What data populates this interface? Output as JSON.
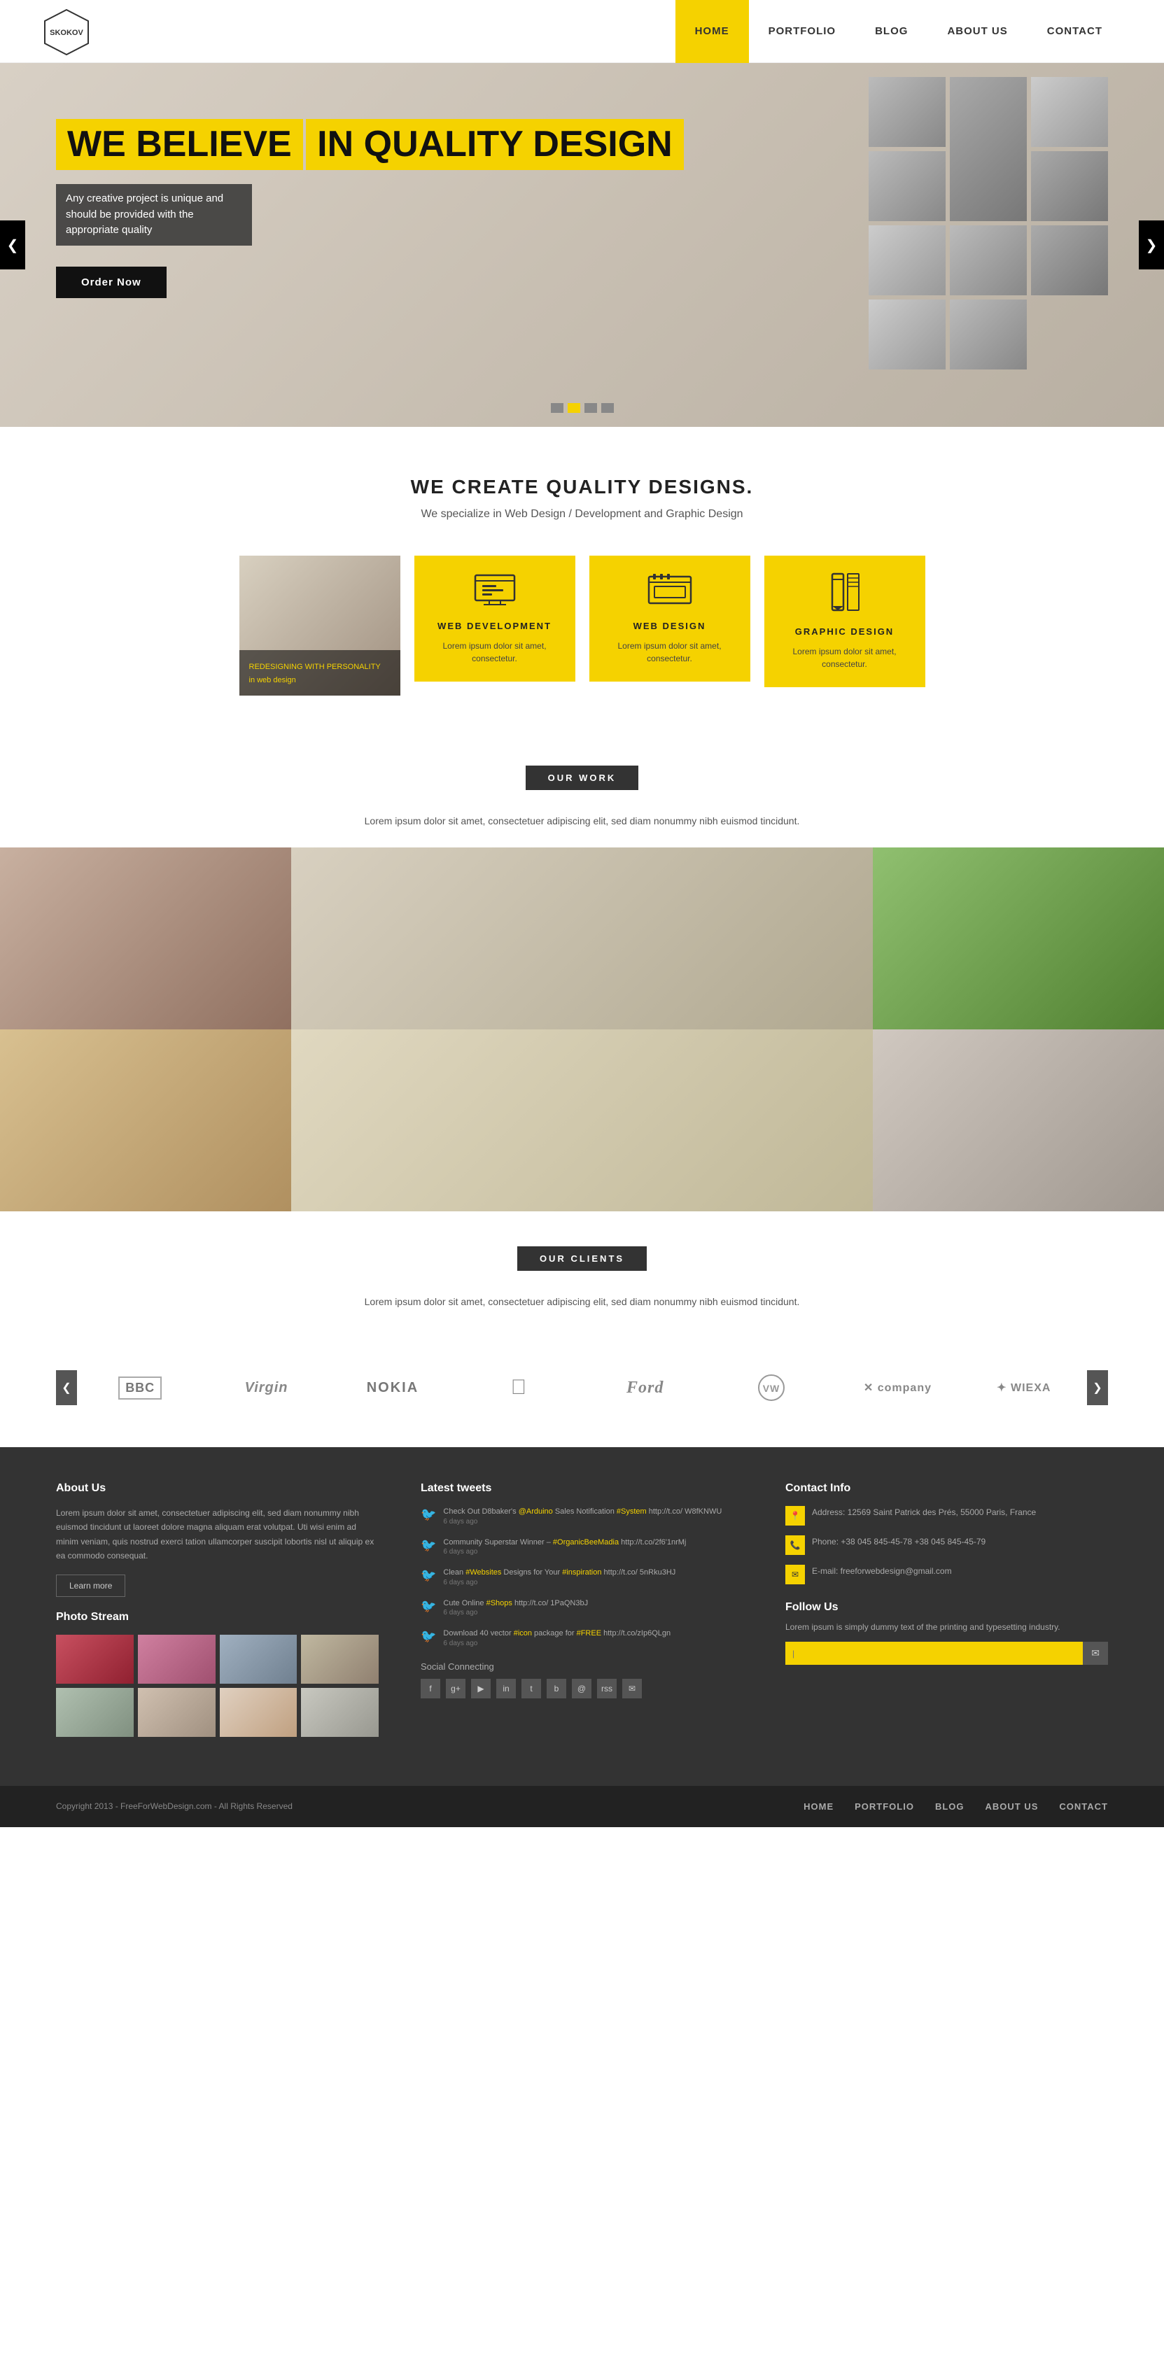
{
  "header": {
    "logo_text": "SKOKOV",
    "nav": [
      {
        "label": "HOME",
        "active": true
      },
      {
        "label": "PORTFOLIO",
        "active": false
      },
      {
        "label": "BLOG",
        "active": false
      },
      {
        "label": "ABOUT US",
        "active": false
      },
      {
        "label": "CONTACT",
        "active": false
      }
    ]
  },
  "hero": {
    "title_line1": "WE BELIEVE",
    "title_line2": "IN QUALITY DESIGN",
    "subtitle": "Any creative project is unique and should be provided with the appropriate quality",
    "cta_button": "Order Now",
    "prev_arrow": "❮",
    "next_arrow": "❯",
    "dots": [
      1,
      2,
      3,
      4
    ]
  },
  "quality": {
    "title": "WE CREATE QUALITY DESIGNS.",
    "subtitle": "We specialize in Web Design / Development and Graphic Design",
    "card_image_title": "REDESIGNING WITH PERSONALITY",
    "card_image_sub": "in web design",
    "services": [
      {
        "icon": "🖥",
        "title": "WEB DEVELOPMENT",
        "text": "Lorem ipsum dolor sit amet, consectetur."
      },
      {
        "icon": "🌐",
        "title": "WEB DESIGN",
        "text": "Lorem ipsum dolor sit amet, consectetur."
      },
      {
        "icon": "✏",
        "title": "GRAPHIC DESIGN",
        "text": "Lorem ipsum dolor sit amet, consectetur."
      }
    ]
  },
  "our_work": {
    "label": "OUR WORK",
    "desc": "Lorem ipsum dolor sit amet, consectetuer adipiscing elit, sed diam nonummy nibh euismod tincidunt."
  },
  "our_clients": {
    "label": "OUR CLIENTS",
    "desc": "Lorem ipsum dolor sit amet, consectetuer adipiscing elit, sed diam nonummy nibh euismod tincidunt.",
    "logos": [
      "BBC",
      "Virgin",
      "NOKIA",
      "🍎",
      "Ford",
      "VW",
      "Xcompany",
      "WIEXA"
    ],
    "prev": "❮",
    "next": "❯"
  },
  "footer": {
    "about": {
      "title": "About Us",
      "text": "Lorem ipsum dolor sit amet, consectetuer adipiscing elit, sed diam nonummy nibh euismod tincidunt ut laoreet dolore magna aliquam erat volutpat. Uti wisi enim ad minim veniam, quis nostrud exerci tation ullamcorper suscipit lobortis nisl ut aliquip ex ea commodo consequat.",
      "learn_more": "Learn more",
      "photo_stream_title": "Photo Stream"
    },
    "tweets": {
      "title": "Latest tweets",
      "items": [
        {
          "text": "Check Out D8baker's @Arduino Sales Notification #System http://t.co/ W8fKNWU",
          "time": "6 days ago"
        },
        {
          "text": "Community Superstar Winner – #OrganicBeeMadia http://t.co/2f6'1nrMj",
          "time": "6 days ago"
        },
        {
          "text": "Clean #Websites Designs for Your #Inspiration http://t.co/ 5nRku3HJ",
          "time": "6 days ago"
        },
        {
          "text": "Cute Online #Shops http://t.co/ 1PaQN3bJ",
          "time": "6 days ago"
        },
        {
          "text": "Download 40 vector #icon package for #FREE http://t.co/zIp6QLgn",
          "time": "6 days ago"
        }
      ],
      "social_connecting": "Social Connecting",
      "social_icons": [
        "f",
        "g+",
        "▶",
        "in",
        "t",
        "b",
        "@",
        "rss",
        "✉"
      ]
    },
    "contact": {
      "title": "Contact Info",
      "address_label": "📍",
      "address": "Address: 12569 Saint Patrick des Prés, 55000 Paris, France",
      "phone_label": "📞",
      "phone": "Phone: +38 045 845-45-78\n+38 045 845-45-79",
      "email_label": "✉",
      "email": "E-mail: freeforwebdesign@gmail.com",
      "follow_title": "Follow Us",
      "follow_text": "Lorem ipsum is simply dummy text of the printing and typesetting industry.",
      "newsletter_placeholder": "|",
      "newsletter_btn": "✉"
    },
    "bottom": {
      "copy": "Copyright 2013 - FreeForWebDesign.com - All Rights Reserved",
      "nav": [
        "HOME",
        "PORTFOLIO",
        "BLOG",
        "ABOUT US",
        "CONTACT"
      ]
    }
  }
}
